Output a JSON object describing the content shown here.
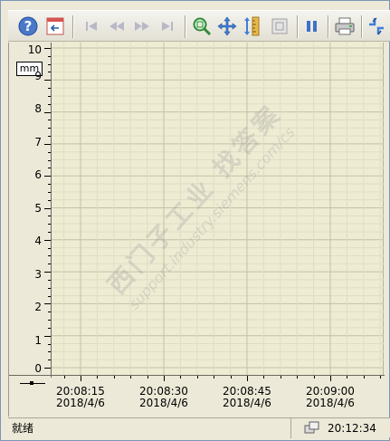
{
  "toolbar": {
    "buttons": [
      {
        "icon": "help-icon"
      },
      {
        "icon": "export-icon"
      },
      {
        "icon": "first-icon"
      },
      {
        "icon": "previous-icon"
      },
      {
        "icon": "next-icon"
      },
      {
        "icon": "last-icon"
      },
      {
        "icon": "zoom-icon"
      },
      {
        "icon": "move-icon"
      },
      {
        "icon": "ruler-icon"
      },
      {
        "icon": "fit-icon"
      },
      {
        "icon": "pause-icon"
      },
      {
        "icon": "print-icon"
      },
      {
        "icon": "switch-icon"
      }
    ]
  },
  "chart": {
    "unit": "mm",
    "y_ticks": [
      "10",
      "9",
      "8",
      "7",
      "6",
      "5",
      "4",
      "3",
      "2",
      "1",
      "0"
    ],
    "x_ticks": [
      {
        "time": "20:08:15",
        "date": "2018/4/6"
      },
      {
        "time": "20:08:30",
        "date": "2018/4/6"
      },
      {
        "time": "20:08:45",
        "date": "2018/4/6"
      },
      {
        "time": "20:09:00",
        "date": "2018/4/6"
      }
    ]
  },
  "chart_data": {
    "type": "line",
    "series": [],
    "ylim": [
      0,
      10
    ],
    "x": [
      "20:08:15",
      "20:08:30",
      "20:08:45",
      "20:09:00"
    ],
    "ylabel": "mm",
    "grid": true
  },
  "status": {
    "text": "就绪",
    "time": "20:12:34"
  },
  "watermark": {
    "line1": "西门子工业 找答案",
    "line2": "support.industry.siemens.com/cs"
  },
  "colors": {
    "plot_bg": "#efecd4",
    "grid": "#cfcbb0",
    "frame": "#ece9d8"
  }
}
